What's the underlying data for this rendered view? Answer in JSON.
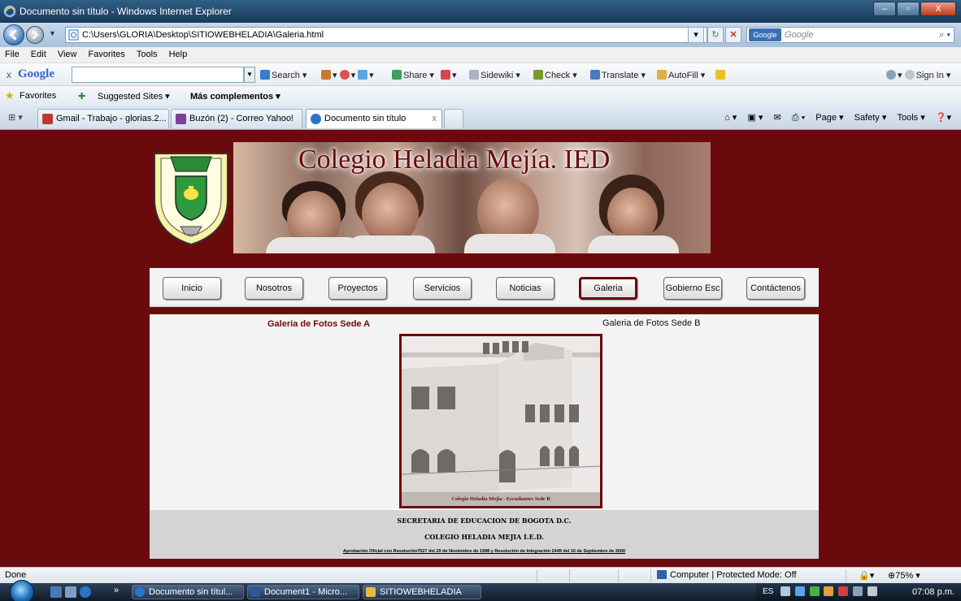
{
  "window": {
    "title": "Documento sin título - Windows Internet Explorer",
    "buttons": {
      "minimize": "–",
      "maximize": "▫",
      "close": "X"
    }
  },
  "address_bar": {
    "url": "C:\\Users\\GLORIA\\Desktop\\SITIOWEBHELADIA\\Galeria.html",
    "search_placeholder": "Google",
    "search_engine": "Google"
  },
  "menu": [
    "File",
    "Edit",
    "View",
    "Favorites",
    "Tools",
    "Help"
  ],
  "google_toolbar": {
    "logo": "Google",
    "items": [
      "Search ▾",
      "Share ▾",
      "Sidewiki ▾",
      "Check ▾",
      "Translate ▾",
      "AutoFill ▾",
      "Sign In ▾"
    ]
  },
  "favorites_bar": {
    "favorites_label": "Favorites",
    "suggested": "Suggested Sites ▾",
    "more": "Más complementos ▾"
  },
  "tabs": [
    {
      "label": "Gmail - Trabajo - glorias.2...",
      "icon_color": "#c0392b",
      "active": false
    },
    {
      "label": "Buzón (2) - Correo Yahoo!",
      "icon_color": "#7b3fa0",
      "active": false
    },
    {
      "label": "Documento sin título",
      "icon_color": "#2a74c8",
      "active": true
    }
  ],
  "command_bar": [
    "Page ▾",
    "Safety ▾",
    "Tools ▾"
  ],
  "site": {
    "banner_title": "Colegio Heladia Mejía. IED",
    "nav": [
      "Inicio",
      "Nosotros",
      "Proyectos",
      "Servicios",
      "Noticias",
      "Galeria",
      "Gobierno Esc",
      "Contáctenos"
    ],
    "current_nav": "Galeria",
    "gallery_a": "Galeria de Fotos Sede A",
    "gallery_b": "Galeria de Fotos Sede B",
    "photo_caption": "Colegio Heladia Mejía - Escudiantes Sede B",
    "footer_line1": "SECRETARIA DE EDUCACION DE BOGOTA D.C.",
    "footer_line2": "COLEGIO HELADIA MEJIA I.E.D.",
    "footer_line3": "Aprobación Oficial con Resolución7527 del 20 de Noviembre de 1998 y Resolución de Integración 2449 del 16 de Septiembre de 2000"
  },
  "status_bar": {
    "status": "Done",
    "zone": "Computer | Protected Mode: Off",
    "zoom": "75%"
  },
  "taskbar": {
    "tasks": [
      {
        "label": "Documento sin títul...",
        "icon_color": "#2a74c8"
      },
      {
        "label": "Document1 - Micro...",
        "icon_color": "#2b579a"
      },
      {
        "label": "SITIOWEBHELADIA",
        "icon_color": "#e8b64c"
      }
    ],
    "language": "ES",
    "time": "07:08 p.m."
  },
  "colors": {
    "page_background": "#6b0a0c",
    "brand": "#6b0a0c",
    "nav_strip": "#f3f3f3",
    "footer": "#d4d4d4"
  }
}
